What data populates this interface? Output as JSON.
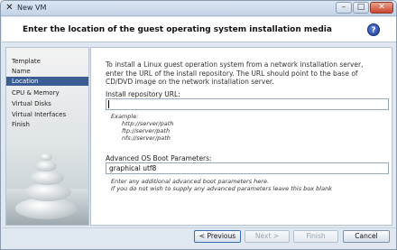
{
  "window": {
    "title": "New VM",
    "app_icon": "x-logo-icon",
    "controls": [
      "minimize-icon",
      "maximize-icon",
      "close-icon"
    ]
  },
  "header": {
    "title": "Enter the location of the guest operating system installation media",
    "help_glyph": "?"
  },
  "sidebar": {
    "items": [
      {
        "label": "Template",
        "active": false
      },
      {
        "label": "Name",
        "active": false
      },
      {
        "label": "Location",
        "active": true
      },
      {
        "label": "CPU & Memory",
        "active": false
      },
      {
        "label": "Virtual Disks",
        "active": false
      },
      {
        "label": "Virtual Interfaces",
        "active": false
      },
      {
        "label": "Finish",
        "active": false
      }
    ]
  },
  "main": {
    "intro_lines": [
      "To install a Linux guest operation system from a network installation server,",
      "enter the URL of the install repository. The URL should point to the base of",
      "CD/DVD image on the network installation server."
    ],
    "repo_label": "Install repository URL:",
    "repo_value": "",
    "example_label": "Example:",
    "examples": [
      "http://server/path",
      "ftp://server/path",
      "nfs://server/path"
    ],
    "boot_label": "Advanced OS Boot Parameters:",
    "boot_value": "graphical utf8",
    "boot_hint_1": "Enter any additional advanced boot parameters here.",
    "boot_hint_2": "If you do not wish to supply any advanced parameters leave this box blank"
  },
  "buttons": {
    "previous": "< Previous",
    "next": "Next >",
    "finish": "Finish",
    "cancel": "Cancel"
  },
  "colors": {
    "active_nav": "#3a5e93",
    "header_bg": "#ffffff",
    "window_bg": "#dfe7f0"
  }
}
